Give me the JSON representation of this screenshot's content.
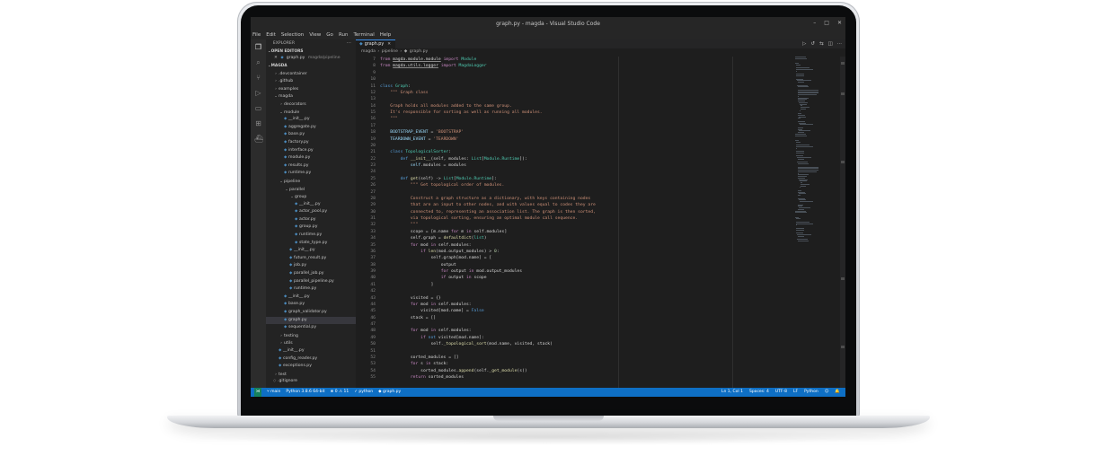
{
  "window": {
    "title": "graph.py - magda - Visual Studio Code"
  },
  "menu": [
    "File",
    "Edit",
    "Selection",
    "View",
    "Go",
    "Run",
    "Terminal",
    "Help"
  ],
  "activity_icons": [
    "files-icon",
    "search-icon",
    "source-control-icon",
    "debug-icon",
    "remote-explorer-icon",
    "extensions-icon",
    "docker-icon"
  ],
  "sidebar": {
    "header": "EXPLORER",
    "open_editors_label": "OPEN EDITORS",
    "open_editor": {
      "name": "graph.py",
      "path": "magda/pipeline"
    },
    "project_label": "MAGDA",
    "tree": [
      {
        "label": ".devcontainer",
        "depth": 1,
        "kind": "folder",
        "open": false
      },
      {
        "label": ".github",
        "depth": 1,
        "kind": "folder",
        "open": false
      },
      {
        "label": "examples",
        "depth": 1,
        "kind": "folder",
        "open": false
      },
      {
        "label": "magda",
        "depth": 1,
        "kind": "folder",
        "open": true
      },
      {
        "label": "decorators",
        "depth": 2,
        "kind": "folder",
        "open": false
      },
      {
        "label": "module",
        "depth": 2,
        "kind": "folder",
        "open": true
      },
      {
        "label": "__init__.py",
        "depth": 3,
        "kind": "py"
      },
      {
        "label": "aggregate.py",
        "depth": 3,
        "kind": "py"
      },
      {
        "label": "base.py",
        "depth": 3,
        "kind": "py"
      },
      {
        "label": "factory.py",
        "depth": 3,
        "kind": "py"
      },
      {
        "label": "interface.py",
        "depth": 3,
        "kind": "py"
      },
      {
        "label": "module.py",
        "depth": 3,
        "kind": "py"
      },
      {
        "label": "results.py",
        "depth": 3,
        "kind": "py"
      },
      {
        "label": "runtime.py",
        "depth": 3,
        "kind": "py"
      },
      {
        "label": "pipeline",
        "depth": 2,
        "kind": "folder",
        "open": true
      },
      {
        "label": "parallel",
        "depth": 3,
        "kind": "folder",
        "open": true
      },
      {
        "label": "group",
        "depth": 4,
        "kind": "folder",
        "open": true
      },
      {
        "label": "__init__.py",
        "depth": 5,
        "kind": "py"
      },
      {
        "label": "actor_pool.py",
        "depth": 5,
        "kind": "py"
      },
      {
        "label": "actor.py",
        "depth": 5,
        "kind": "py"
      },
      {
        "label": "group.py",
        "depth": 5,
        "kind": "py"
      },
      {
        "label": "runtime.py",
        "depth": 5,
        "kind": "py"
      },
      {
        "label": "state_type.py",
        "depth": 5,
        "kind": "py"
      },
      {
        "label": "__init__.py",
        "depth": 4,
        "kind": "py"
      },
      {
        "label": "future_result.py",
        "depth": 4,
        "kind": "py"
      },
      {
        "label": "job.py",
        "depth": 4,
        "kind": "py"
      },
      {
        "label": "parallel_job.py",
        "depth": 4,
        "kind": "py"
      },
      {
        "label": "parallel_pipeline.py",
        "depth": 4,
        "kind": "py"
      },
      {
        "label": "runtime.py",
        "depth": 4,
        "kind": "py"
      },
      {
        "label": "__init__.py",
        "depth": 3,
        "kind": "py"
      },
      {
        "label": "base.py",
        "depth": 3,
        "kind": "py"
      },
      {
        "label": "graph_validator.py",
        "depth": 3,
        "kind": "py"
      },
      {
        "label": "graph.py",
        "depth": 3,
        "kind": "py",
        "selected": true
      },
      {
        "label": "sequential.py",
        "depth": 3,
        "kind": "py"
      },
      {
        "label": "testing",
        "depth": 2,
        "kind": "folder",
        "open": false
      },
      {
        "label": "utils",
        "depth": 2,
        "kind": "folder",
        "open": false
      },
      {
        "label": "__init__.py",
        "depth": 2,
        "kind": "py"
      },
      {
        "label": "config_reader.py",
        "depth": 2,
        "kind": "py"
      },
      {
        "label": "exceptions.py",
        "depth": 2,
        "kind": "py"
      },
      {
        "label": "test",
        "depth": 1,
        "kind": "folder",
        "open": false
      },
      {
        "label": ".gitignore",
        "depth": 1,
        "kind": "git"
      }
    ]
  },
  "editor": {
    "tab_label": "graph.py",
    "breadcrumb": [
      "magda",
      "pipeline",
      "graph.py"
    ],
    "first_line": 7,
    "lines": [
      [
        [
          "from ",
          "kw2"
        ],
        [
          "magda.module.module",
          "uline"
        ],
        [
          " import ",
          "kw2"
        ],
        [
          "Module",
          "cls"
        ]
      ],
      [
        [
          "from ",
          "kw2"
        ],
        [
          "magda.utils.logger",
          "uline"
        ],
        [
          " import ",
          "kw2"
        ],
        [
          "MagdaLogger",
          "cls"
        ]
      ],
      [],
      [],
      [
        [
          "class ",
          "kw"
        ],
        [
          "Graph",
          "cls"
        ],
        [
          ":",
          ""
        ]
      ],
      [
        [
          "    \"\"\" Graph class",
          "doc"
        ]
      ],
      [],
      [
        [
          "    Graph holds all modules added to the same group.",
          "doc"
        ]
      ],
      [
        [
          "    It's responsible for sorting as well as running all modules.",
          "doc"
        ]
      ],
      [
        [
          "    \"\"\"",
          "doc"
        ]
      ],
      [],
      [
        [
          "    BOOTSTRAP_EVENT",
          "var"
        ],
        [
          " = ",
          ""
        ],
        [
          "'BOOTSTRAP'",
          "str"
        ]
      ],
      [
        [
          "    TEARDOWN_EVENT",
          "var"
        ],
        [
          " = ",
          ""
        ],
        [
          "'TEARDOWN'",
          "str"
        ]
      ],
      [],
      [
        [
          "    class ",
          "kw"
        ],
        [
          "TopologicalSorter",
          "cls"
        ],
        [
          ":",
          ""
        ]
      ],
      [
        [
          "        def ",
          "kw"
        ],
        [
          "__init__",
          "fn"
        ],
        [
          "(self, modules: ",
          ""
        ],
        [
          "List",
          "cls"
        ],
        [
          "[",
          ""
        ],
        [
          "Module.Runtime",
          "cls"
        ],
        [
          "]):",
          ""
        ]
      ],
      [
        [
          "            self",
          "var"
        ],
        [
          ".modules = modules",
          ""
        ]
      ],
      [],
      [
        [
          "        def ",
          "kw"
        ],
        [
          "get",
          "fn"
        ],
        [
          "(self) -> ",
          ""
        ],
        [
          "List",
          "cls"
        ],
        [
          "[",
          ""
        ],
        [
          "Module.Runtime",
          "cls"
        ],
        [
          "]:",
          ""
        ]
      ],
      [
        [
          "            \"\"\" Get topological order of modules.",
          "doc"
        ]
      ],
      [],
      [
        [
          "            Construct a graph structure as a dictionary, with keys containing nodes",
          "doc"
        ]
      ],
      [
        [
          "            that are an input to other nodes, and with values equal to codes they are",
          "doc"
        ]
      ],
      [
        [
          "            connected to, representing an association list. The graph is then sorted,",
          "doc"
        ]
      ],
      [
        [
          "            via topological sorting, ensuring an optimal module call sequence.",
          "doc"
        ]
      ],
      [
        [
          "            \"\"\"",
          "doc"
        ]
      ],
      [
        [
          "            scope = [m.name ",
          ""
        ],
        [
          "for ",
          "kw2"
        ],
        [
          "m ",
          ""
        ],
        [
          "in ",
          "kw2"
        ],
        [
          "self",
          ""
        ],
        [
          ".modules]",
          ""
        ]
      ],
      [
        [
          "            self",
          ""
        ],
        [
          ".graph = ",
          ""
        ],
        [
          "defaultdict",
          "fn"
        ],
        [
          "(",
          ""
        ],
        [
          "list",
          "cls"
        ],
        [
          ")",
          ""
        ]
      ],
      [
        [
          "            for ",
          "kw2"
        ],
        [
          "mod ",
          ""
        ],
        [
          "in ",
          "kw2"
        ],
        [
          "self.modules:",
          ""
        ]
      ],
      [
        [
          "                if ",
          "kw2"
        ],
        [
          "len",
          "fn"
        ],
        [
          "(mod.output_modules) > ",
          ""
        ],
        [
          "0",
          "num"
        ],
        [
          ":",
          ""
        ]
      ],
      [
        [
          "                    self",
          ""
        ],
        [
          ".graph[mod.name] = [",
          ""
        ]
      ],
      [
        [
          "                        output",
          ""
        ]
      ],
      [
        [
          "                        for ",
          "kw2"
        ],
        [
          "output ",
          ""
        ],
        [
          "in ",
          "kw2"
        ],
        [
          "mod.output_modules",
          ""
        ]
      ],
      [
        [
          "                        if ",
          "kw2"
        ],
        [
          "output ",
          ""
        ],
        [
          "in ",
          "kw2"
        ],
        [
          "scope",
          ""
        ]
      ],
      [
        [
          "                    ]",
          ""
        ]
      ],
      [],
      [
        [
          "            visited = {}",
          ""
        ]
      ],
      [
        [
          "            for ",
          "kw2"
        ],
        [
          "mod ",
          ""
        ],
        [
          "in ",
          "kw2"
        ],
        [
          "self.modules:",
          ""
        ]
      ],
      [
        [
          "                visited[mod.name] = ",
          ""
        ],
        [
          "False",
          "kw"
        ]
      ],
      [
        [
          "            stack = []",
          ""
        ]
      ],
      [],
      [
        [
          "            for ",
          "kw2"
        ],
        [
          "mod ",
          ""
        ],
        [
          "in ",
          "kw2"
        ],
        [
          "self.modules:",
          ""
        ]
      ],
      [
        [
          "                if ",
          "kw2"
        ],
        [
          "not ",
          "kw"
        ],
        [
          "visited[mod.name]:",
          ""
        ]
      ],
      [
        [
          "                    self",
          ""
        ],
        [
          ".",
          ""
        ],
        [
          "_topological_sort",
          "fn"
        ],
        [
          "(mod.name, visited, stack)",
          ""
        ]
      ],
      [],
      [
        [
          "            sorted_modules = []",
          ""
        ]
      ],
      [
        [
          "            for ",
          "kw2"
        ],
        [
          "s ",
          ""
        ],
        [
          "in ",
          "kw2"
        ],
        [
          "stack:",
          ""
        ]
      ],
      [
        [
          "                sorted_modules.",
          ""
        ],
        [
          "append",
          "fn"
        ],
        [
          "(self.",
          ""
        ],
        [
          "_get_module",
          "fn"
        ],
        [
          "(s))",
          ""
        ]
      ],
      [
        [
          "            return ",
          "kw2"
        ],
        [
          "sorted_modules",
          ""
        ]
      ]
    ]
  },
  "statusbar": {
    "left": [
      "main",
      "Python 3.8.6 64-bit",
      "⊗ 0  ⚠ 11",
      "python",
      "graph.py"
    ],
    "right": [
      "Ln 1, Col 1",
      "Spaces: 4",
      "UTF-8",
      "LF",
      "Python"
    ]
  }
}
